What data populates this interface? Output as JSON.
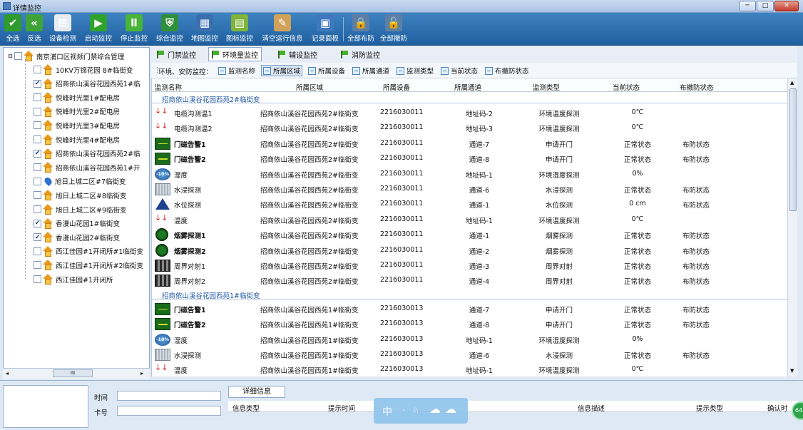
{
  "window": {
    "title": "详情监控",
    "min": "─",
    "max": "□",
    "close": "✕"
  },
  "toolbar": [
    {
      "name": "select-all",
      "label": "全选",
      "icon": "check-icon",
      "glyph": "✔",
      "color": "#2f9b2c"
    },
    {
      "name": "invert-select",
      "label": "反选",
      "icon": "double-left-icon",
      "glyph": "«",
      "color": "#3fa33a"
    },
    {
      "name": "device-check",
      "label": "设备检测",
      "icon": "network-icon",
      "glyph": "⊞",
      "color": "#e7ecf2"
    },
    {
      "name": "start-monitor",
      "label": "启动监控",
      "icon": "play-icon",
      "glyph": "▶",
      "color": "#2fa32c"
    },
    {
      "name": "stop-monitor",
      "label": "停止监控",
      "icon": "pause-icon",
      "glyph": "Ⅱ",
      "color": "#49b33a"
    },
    {
      "name": "integrated-monitor",
      "label": "综合监控",
      "icon": "shield-icon",
      "glyph": "⛨",
      "color": "#2f8f3a"
    },
    {
      "name": "map-monitor",
      "label": "地图监控",
      "icon": "map-icon",
      "glyph": "▦",
      "color": "#3b6fb0"
    },
    {
      "name": "icon-monitor",
      "label": "图标监控",
      "icon": "grid-icon",
      "glyph": "▤",
      "color": "#7fb33a"
    },
    {
      "name": "clear-info",
      "label": "清空运行信息",
      "icon": "broom-icon",
      "glyph": "✎",
      "color": "#d1a35a"
    },
    {
      "name": "record-panel",
      "label": "记录面板",
      "icon": "clipboard-icon",
      "glyph": "▣",
      "color": "#3f78c0"
    },
    {
      "name": "arm-all",
      "label": "全部布防",
      "icon": "lock-icon",
      "glyph": "🔒",
      "color": "#5d7fa6"
    },
    {
      "name": "disarm-all",
      "label": "全部撤防",
      "icon": "unlock-icon",
      "glyph": "🔓",
      "color": "#5d7fa6"
    }
  ],
  "tree": {
    "root": "南京浦口区视频门禁综合管理",
    "items": [
      {
        "label": "10KV万锦花园 8#临街变",
        "checked": false,
        "icon": "house"
      },
      {
        "label": "招商依山溪谷花园西苑1#临",
        "checked": true,
        "icon": "house"
      },
      {
        "label": "悦峰时光里1#配电房",
        "checked": false,
        "icon": "house"
      },
      {
        "label": "悦峰时光里2#配电房",
        "checked": false,
        "icon": "house"
      },
      {
        "label": "悦峰时光里3#配电房",
        "checked": false,
        "icon": "house"
      },
      {
        "label": "悦峰时光里4#配电房",
        "checked": false,
        "icon": "house"
      },
      {
        "label": "招商依山溪谷花园西苑2#临",
        "checked": true,
        "icon": "house"
      },
      {
        "label": "招商依山溪谷花园西苑1#开",
        "checked": false,
        "icon": "house"
      },
      {
        "label": "旭日上城二区#7临街变",
        "checked": false,
        "icon": "pin"
      },
      {
        "label": "旭日上城二区#8临街变",
        "checked": false,
        "icon": "house"
      },
      {
        "label": "旭日上城二区#9临街变",
        "checked": false,
        "icon": "house"
      },
      {
        "label": "香漫山花园1#临街变",
        "checked": true,
        "icon": "house"
      },
      {
        "label": "香漫山花园2#临街变",
        "checked": true,
        "icon": "house"
      },
      {
        "label": "西江佳园#1开闭所#1临街变",
        "checked": false,
        "icon": "house"
      },
      {
        "label": "西江佳园#1开闭所#2临街变",
        "checked": false,
        "icon": "house"
      },
      {
        "label": "西江佳园#1开闭所",
        "checked": false,
        "icon": "house"
      }
    ],
    "scroll_mark": "III"
  },
  "tabs": [
    "门禁监控",
    "环境量监控",
    "辅设监控",
    "消防监控"
  ],
  "filter": {
    "label": "环境、安防监控：",
    "items": [
      "监测名称",
      "所属区域",
      "所属设备",
      "所属通道",
      "监测类型",
      "当前状态",
      "布撤防状态"
    ]
  },
  "columns": [
    "监测名称",
    "所属区域",
    "所属设备",
    "所属通道",
    "监测类型",
    "当前状态",
    "布撤防状态"
  ],
  "groups": [
    {
      "title": "招商依山溪谷花园西苑2#临街变",
      "rows": [
        {
          "icon": "temp",
          "name": "电缆沟测温1",
          "area": "招商依山溪谷花园西苑2#临街变",
          "device": "2216030011",
          "channel": "地址码-2",
          "type": "环境温度探测",
          "state": "0℃",
          "arm": ""
        },
        {
          "icon": "temp",
          "name": "电缆沟测温2",
          "area": "招商依山溪谷花园西苑2#临街变",
          "device": "2216030011",
          "channel": "地址码-3",
          "type": "环境温度探测",
          "state": "0℃",
          "arm": ""
        },
        {
          "icon": "door",
          "name": "门磁告警1",
          "area": "招商依山溪谷花园西苑2#临街变",
          "device": "2216030011",
          "channel": "通道-7",
          "type": "申请开门",
          "state": "正常状态",
          "arm": "布防状态"
        },
        {
          "icon": "door",
          "name": "门磁告警2",
          "area": "招商依山溪谷花园西苑2#临街变",
          "device": "2216030011",
          "channel": "通道-8",
          "type": "申请开门",
          "state": "正常状态",
          "arm": "布防状态"
        },
        {
          "icon": "hum",
          "name": "湿度",
          "area": "招商依山溪谷花园西苑2#临街变",
          "device": "2216030011",
          "channel": "地址码-1",
          "type": "环境湿度探测",
          "state": "0%",
          "arm": ""
        },
        {
          "icon": "water",
          "name": "水浸探测",
          "area": "招商依山溪谷花园西苑2#临街变",
          "device": "2216030011",
          "channel": "通道-6",
          "type": "水浸探测",
          "state": "正常状态",
          "arm": "布防状态"
        },
        {
          "icon": "level",
          "name": "水位探测",
          "area": "招商依山溪谷花园西苑2#临街变",
          "device": "2216030011",
          "channel": "通道-1",
          "type": "水位探测",
          "state": "0 cm",
          "arm": "布防状态"
        },
        {
          "icon": "temp",
          "name": "温度",
          "area": "招商依山溪谷花园西苑2#临街变",
          "device": "2216030011",
          "channel": "地址码-1",
          "type": "环境温度探测",
          "state": "0℃",
          "arm": ""
        },
        {
          "icon": "smoke",
          "name": "烟雾探测1",
          "area": "招商依山溪谷花园西苑2#临街变",
          "device": "2216030011",
          "channel": "通道-1",
          "type": "烟雾探测",
          "state": "正常状态",
          "arm": "布防状态"
        },
        {
          "icon": "smoke",
          "name": "烟雾探测2",
          "area": "招商依山溪谷花园西苑2#临街变",
          "device": "2216030011",
          "channel": "通道-2",
          "type": "烟雾探测",
          "state": "正常状态",
          "arm": "布防状态"
        },
        {
          "icon": "beam",
          "name": "周界对射1",
          "area": "招商依山溪谷花园西苑2#临街变",
          "device": "2216030011",
          "channel": "通道-3",
          "type": "周界对射",
          "state": "正常状态",
          "arm": "布防状态"
        },
        {
          "icon": "beam",
          "name": "周界对射2",
          "area": "招商依山溪谷花园西苑2#临街变",
          "device": "2216030011",
          "channel": "通道-4",
          "type": "周界对射",
          "state": "正常状态",
          "arm": "布防状态"
        }
      ]
    },
    {
      "title": "招商依山溪谷花园西苑1#临街变",
      "rows": [
        {
          "icon": "door",
          "name": "门磁告警1",
          "area": "招商依山溪谷花园西苑1#临街变",
          "device": "2216030013",
          "channel": "通道-7",
          "type": "申请开门",
          "state": "正常状态",
          "arm": "布防状态"
        },
        {
          "icon": "door",
          "name": "门磁告警2",
          "area": "招商依山溪谷花园西苑1#临街变",
          "device": "2216030013",
          "channel": "通道-8",
          "type": "申请开门",
          "state": "正常状态",
          "arm": "布防状态"
        },
        {
          "icon": "hum",
          "name": "湿度",
          "area": "招商依山溪谷花园西苑1#临街变",
          "device": "2216030013",
          "channel": "地址码-1",
          "type": "环境湿度探测",
          "state": "0%",
          "arm": ""
        },
        {
          "icon": "water",
          "name": "水浸探测",
          "area": "招商依山溪谷花园西苑1#临街变",
          "device": "2216030013",
          "channel": "通道-6",
          "type": "水浸探测",
          "state": "正常状态",
          "arm": "布防状态"
        },
        {
          "icon": "temp",
          "name": "温度",
          "area": "招商依山溪谷花园西苑1#临街变",
          "device": "2216030013",
          "channel": "地址码-1",
          "type": "环境温度探测",
          "state": "0℃",
          "arm": ""
        }
      ]
    }
  ],
  "bottom": {
    "time_label": "时间",
    "card_label": "卡号",
    "tab": "详细信息",
    "columns": [
      "信息类型",
      "提示时间",
      "信息描述",
      "提示类型",
      "确认时"
    ]
  },
  "ime": {
    "mode": "中",
    "badge": "64"
  },
  "hum_badge": "-10%"
}
